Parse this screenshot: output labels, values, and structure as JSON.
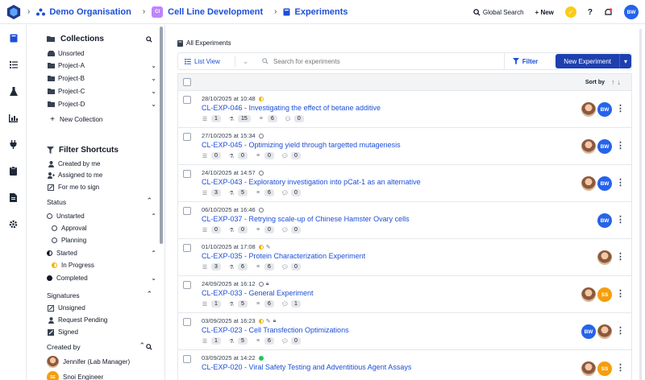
{
  "header": {
    "org": "Demo Organisation",
    "project_badge": "CI",
    "project": "Cell Line Development",
    "section": "Experiments",
    "global_search": "Global Search",
    "new": "+ New",
    "help": "?",
    "user_initials": "BW"
  },
  "sidebar": {
    "collections_title": "Collections",
    "collections": [
      "Unsorted",
      "Project-A",
      "Project-B",
      "Project-C",
      "Project-D"
    ],
    "new_collection": "New Collection",
    "filter_title": "Filter Shortcuts",
    "shortcuts": [
      "Created by me",
      "Assigned to me",
      "For me to sign"
    ],
    "status_label": "Status",
    "unstarted": "Unstarted",
    "approval": "Approval",
    "planning": "Planning",
    "started": "Started",
    "in_progress": "In Progress",
    "completed": "Completed",
    "signatures_label": "Signatures",
    "signatures": [
      "Unsigned",
      "Request Pending",
      "Signed"
    ],
    "created_by_label": "Created by",
    "creators": [
      "Jennifer (Lab Manager)",
      "Snoi Engineer"
    ]
  },
  "main": {
    "all_experiments": "All Experiments",
    "list_view": "List View",
    "search_placeholder": "Search for experiments",
    "filter": "Filter",
    "new_experiment": "New Experiment",
    "sort_by": "Sort by"
  },
  "experiments": [
    {
      "date": "28/10/2025 at 10:48",
      "title": "CL-EXP-046 - Investigating the effect of betane additive",
      "steps": "1",
      "samples": "15",
      "db": "6",
      "comments": "0"
    },
    {
      "date": "27/10/2025 at 15:34",
      "title": "CL-EXP-045 - Optimizing yield through targetted mutagenesis",
      "steps": "0",
      "samples": "0",
      "db": "0",
      "comments": "0"
    },
    {
      "date": "24/10/2025 at 14:57",
      "title": "CL-EXP-043 - Exploratory investigation into pCat-1 as an alternative",
      "steps": "3",
      "samples": "5",
      "db": "6",
      "comments": "0"
    },
    {
      "date": "06/10/2025 at 16:46",
      "title": "CL-EXP-037 - Retrying scale-up of Chinese Hamster Ovary cells",
      "steps": "0",
      "samples": "0",
      "db": "0",
      "comments": "0"
    },
    {
      "date": "01/10/2025 at 17:08",
      "title": "CL-EXP-035 - Protein Characterization Experiment",
      "steps": "3",
      "samples": "6",
      "db": "6",
      "comments": "0"
    },
    {
      "date": "24/09/2025 at 16:12",
      "title": "CL-EXP-033 - General Experiment",
      "steps": "1",
      "samples": "5",
      "db": "6",
      "comments": "1"
    },
    {
      "date": "03/09/2025 at 16:23",
      "title": "CL-EXP-023 - Cell Transfection Optimizations",
      "steps": "1",
      "samples": "5",
      "db": "6",
      "comments": "0"
    },
    {
      "date": "03/09/2025 at 14:22",
      "title": "CL-EXP-020 - Viral Safety Testing and Adventitious Agent Assays",
      "steps": "",
      "samples": "",
      "db": "",
      "comments": ""
    }
  ]
}
